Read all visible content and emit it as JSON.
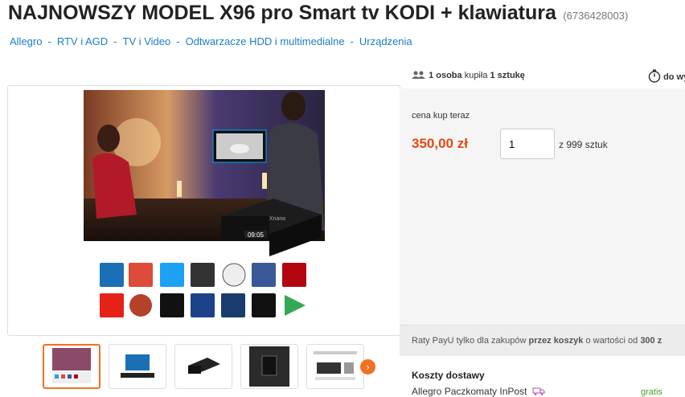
{
  "product": {
    "title": "NAJNOWSZY MODEL X96 pro Smart tv KODI + klawiatura",
    "offer_id": "(6736428003)"
  },
  "breadcrumbs": [
    "Allegro",
    "RTV i AGD",
    "TV i Video",
    "Odtwarzacze HDD i multimedialne",
    "Urządzenia"
  ],
  "buyers": {
    "count": "1 osoba",
    "verb": " kupiła ",
    "qty": "1 sztukę"
  },
  "timer": {
    "label": "do wy"
  },
  "purchase": {
    "price_label": "cena kup teraz",
    "price": "350,00 zł",
    "quantity": "1",
    "of_stock": "z 999 sztuk"
  },
  "installments": {
    "part1": "Raty PayU tylko dla zakupów ",
    "bold1": "przez koszyk",
    "part2": " o wartości od ",
    "bold2": "300 z"
  },
  "delivery": {
    "title": "Koszty dostawy",
    "method": "Allegro Paczkomaty InPost",
    "cost": "gratis"
  },
  "image_overlay": {
    "box_clock": "09:05",
    "box_brand": "Xnano"
  },
  "colors": {
    "accent": "#f37021",
    "price": "#e24a14",
    "link": "#1b7fc4",
    "free_shipping": "#49a02a"
  }
}
